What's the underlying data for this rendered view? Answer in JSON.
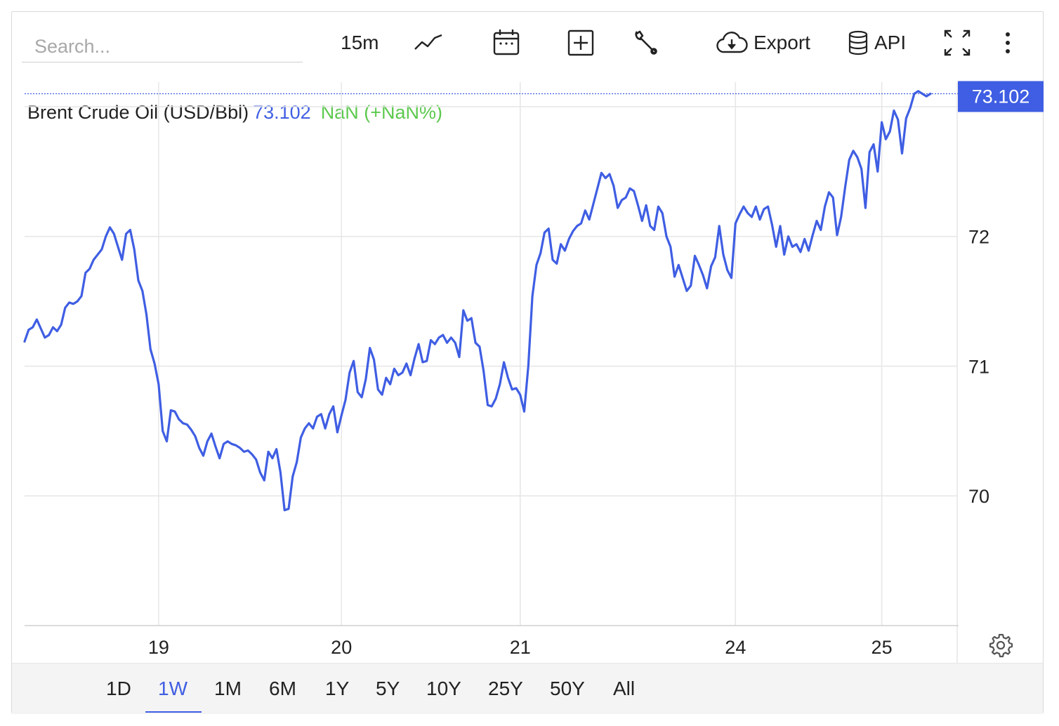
{
  "toolbar": {
    "search_placeholder": "Search...",
    "interval_label": "15m",
    "export_label": "Export",
    "api_label": "API",
    "icons": [
      "line-chart-icon",
      "calendar-icon",
      "add-box-icon",
      "wrench-icon",
      "cloud-download-icon",
      "database-icon",
      "fullscreen-icon",
      "more-vertical-icon"
    ]
  },
  "legend": {
    "name": "Brent Crude Oil (USD/Bbl)",
    "price": "73.102",
    "change": "NaN (+NaN%)"
  },
  "range_buttons": [
    "1D",
    "1W",
    "1M",
    "6M",
    "1Y",
    "5Y",
    "10Y",
    "25Y",
    "50Y",
    "All"
  ],
  "active_range": "1W",
  "colors": {
    "line": "#3f5ee3",
    "change_positive": "#5cc94e",
    "grid": "#e6e6e6"
  },
  "chart_data": {
    "type": "line",
    "title": "",
    "xlabel": "",
    "ylabel": "",
    "x_ticks": [
      "19",
      "20",
      "21",
      "24",
      "25"
    ],
    "y_ticks": [
      "70",
      "71",
      "72"
    ],
    "ylim": [
      69.0,
      73.1
    ],
    "last_value_label": "73.102",
    "series": [
      {
        "values": [
          71.19,
          71.28,
          71.3,
          71.36,
          71.29,
          71.22,
          71.24,
          71.3,
          71.27,
          71.32,
          71.45,
          71.49,
          71.48,
          71.5,
          71.54,
          71.72,
          71.75,
          71.82,
          71.86,
          71.9,
          72.0,
          72.07,
          72.02,
          71.92,
          71.82,
          72.02,
          72.05,
          71.9,
          71.66,
          71.58,
          71.4,
          71.13,
          71.02,
          70.86,
          70.5,
          70.42,
          70.66,
          70.65,
          70.59,
          70.56,
          70.55,
          70.51,
          70.46,
          70.37,
          70.31,
          70.42,
          70.48,
          70.38,
          70.29,
          70.4,
          70.42,
          70.4,
          70.39,
          70.37,
          70.34,
          70.35,
          70.32,
          70.28,
          70.18,
          70.12,
          70.34,
          70.29,
          70.36,
          70.18,
          69.89,
          69.9,
          70.15,
          70.26,
          70.45,
          70.52,
          70.56,
          70.52,
          70.61,
          70.63,
          70.52,
          70.63,
          70.69,
          70.49,
          70.62,
          70.74,
          70.95,
          71.04,
          70.8,
          70.76,
          70.9,
          71.14,
          71.05,
          70.82,
          70.78,
          70.91,
          70.86,
          70.98,
          70.93,
          70.95,
          71.02,
          70.93,
          71.06,
          71.17,
          71.03,
          71.04,
          71.2,
          71.17,
          71.22,
          71.24,
          71.18,
          71.22,
          71.18,
          71.07,
          71.43,
          71.35,
          71.37,
          71.18,
          71.15,
          70.96,
          70.7,
          70.69,
          70.75,
          70.86,
          71.03,
          70.91,
          70.82,
          70.83,
          70.78,
          70.65,
          71.0,
          71.54,
          71.78,
          71.87,
          72.03,
          72.06,
          71.82,
          71.79,
          71.94,
          71.89,
          71.98,
          72.04,
          72.08,
          72.1,
          72.2,
          72.13,
          72.25,
          72.37,
          72.49,
          72.45,
          72.48,
          72.39,
          72.22,
          72.28,
          72.3,
          72.37,
          72.35,
          72.24,
          72.12,
          72.24,
          72.08,
          72.05,
          72.23,
          72.18,
          72.0,
          71.92,
          71.69,
          71.78,
          71.68,
          71.58,
          71.62,
          71.85,
          71.78,
          71.7,
          71.6,
          71.77,
          71.84,
          72.08,
          71.86,
          71.74,
          71.68,
          72.1,
          72.17,
          72.23,
          72.18,
          72.15,
          72.23,
          72.13,
          72.21,
          72.23,
          72.09,
          71.92,
          72.08,
          71.86,
          72.0,
          71.92,
          71.94,
          71.88,
          71.98,
          71.89,
          72.01,
          72.12,
          72.05,
          72.23,
          72.34,
          72.3,
          72.01,
          72.15,
          72.38,
          72.59,
          72.66,
          72.61,
          72.52,
          72.22,
          72.65,
          72.71,
          72.5,
          72.88,
          72.75,
          72.81,
          72.97,
          72.9,
          72.64,
          72.91,
          72.99,
          73.1,
          73.12,
          73.1,
          73.08,
          73.1
        ]
      }
    ]
  }
}
